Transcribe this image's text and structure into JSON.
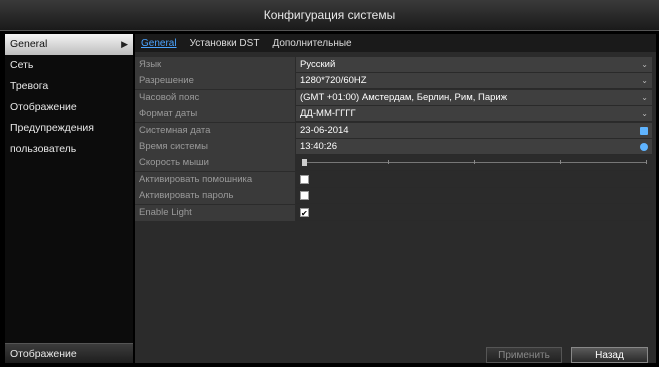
{
  "window": {
    "title": "Конфигурация системы"
  },
  "sidebar": {
    "items": [
      {
        "label": "General"
      },
      {
        "label": "Сеть"
      },
      {
        "label": "Тревога"
      },
      {
        "label": "Отображение"
      },
      {
        "label": "Предупреждения"
      },
      {
        "label": "пользователь"
      }
    ],
    "bottom_label": "Отображение"
  },
  "tabs": [
    {
      "label": "General"
    },
    {
      "label": "Установки DST"
    },
    {
      "label": "Дополнительные"
    }
  ],
  "form": {
    "language": {
      "label": "Язык",
      "value": "Русский"
    },
    "resolution": {
      "label": "Разрешение",
      "value": "1280*720/60HZ"
    },
    "timezone": {
      "label": "Часовой пояс",
      "value": "(GMT +01:00) Амстердам, Берлин, Рим, Париж"
    },
    "date_format": {
      "label": "Формат даты",
      "value": "ДД-ММ-ГГГГ"
    },
    "system_date": {
      "label": "Системная дата",
      "value": "23-06-2014"
    },
    "system_time": {
      "label": "Время системы",
      "value": "13:40:26"
    },
    "mouse_speed": {
      "label": "Скорость мыши"
    },
    "wizard": {
      "label": "Активировать помошника",
      "checked": false
    },
    "password": {
      "label": "Активировать пароль",
      "checked": false
    },
    "light": {
      "label": "Enable Light",
      "checked": true
    }
  },
  "buttons": {
    "apply": "Применить",
    "back": "Назад"
  },
  "colors": {
    "accent": "#4aa3ff",
    "icon": "#5fb4ff"
  }
}
